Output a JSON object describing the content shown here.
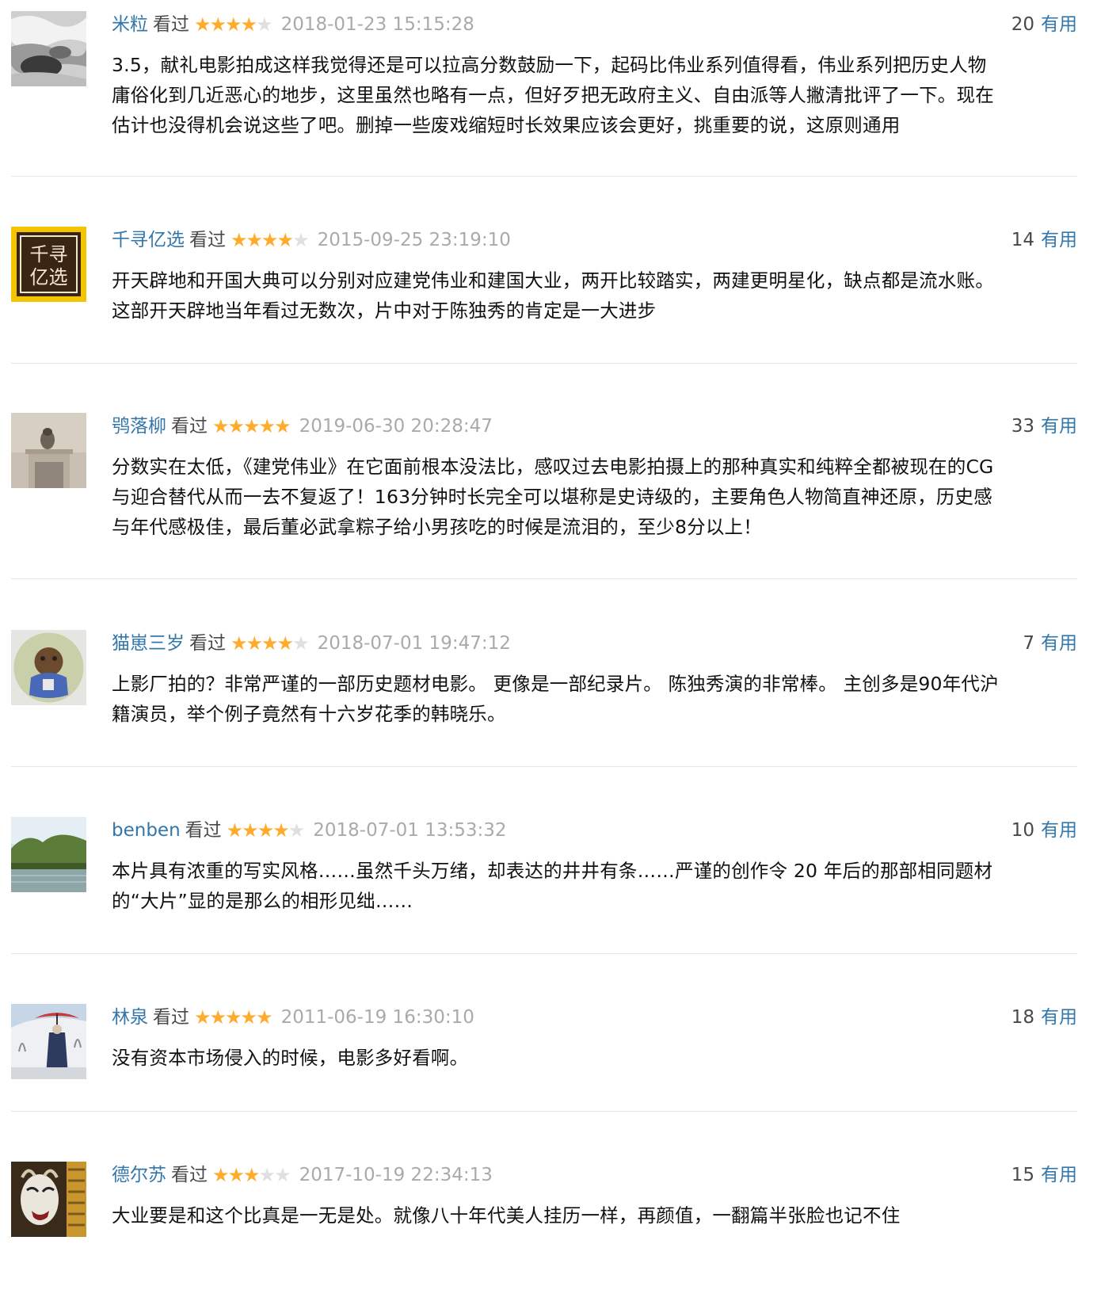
{
  "comments": [
    {
      "user": "米粒",
      "status": "看过",
      "rating": 4,
      "time": "2018-01-23 15:15:28",
      "votes": "20",
      "useful_label": "有用",
      "lines": [
        "3.5，献礼电影拍成这样我觉得还是可以拉高分数鼓励一下，起码比伟业系列值得看，伟业系列把历史人物",
        "庸俗化到几近恶心的地步，这里虽然也略有一点，但好歹把无政府主义、自由派等人撇清批评了一下。现在",
        "估计也没得机会说这些了吧。删掉一些废戏缩短时长效果应该会更好，挑重要的说，这原则通用"
      ]
    },
    {
      "user": "千寻亿选",
      "status": "看过",
      "rating": 4,
      "time": "2015-09-25 23:19:10",
      "votes": "14",
      "useful_label": "有用",
      "avatar_text": [
        "千寻",
        "亿选"
      ],
      "lines": [
        "开天辟地和开国大典可以分别对应建党伟业和建国大业，两开比较踏实，两建更明星化，缺点都是流水账。",
        "这部开天辟地当年看过无数次，片中对于陈独秀的肯定是一大进步"
      ]
    },
    {
      "user": "鸮落柳",
      "status": "看过",
      "rating": 5,
      "time": "2019-06-30 20:28:47",
      "votes": "33",
      "useful_label": "有用",
      "lines": [
        "分数实在太低，《建党伟业》在它面前根本没法比，感叹过去电影拍摄上的那种真实和纯粹全都被现在的CG",
        "与迎合替代从而一去不复返了！163分钟时长完全可以堪称是史诗级的，主要角色人物简直神还原，历史感",
        "与年代感极佳，最后董必武拿粽子给小男孩吃的时候是流泪的，至少8分以上！"
      ]
    },
    {
      "user": "猫崽三岁",
      "status": "看过",
      "rating": 4,
      "time": "2018-07-01 19:47:12",
      "votes": "7",
      "useful_label": "有用",
      "lines": [
        "上影厂拍的？非常严谨的一部历史题材电影。 更像是一部纪录片。 陈独秀演的非常棒。 主创多是90年代沪",
        "籍演员，举个例子竟然有十六岁花季的韩晓乐。"
      ]
    },
    {
      "user": "benben",
      "status": "看过",
      "rating": 4,
      "time": "2018-07-01 13:53:32",
      "votes": "10",
      "useful_label": "有用",
      "lines": [
        "本片具有浓重的写实风格……虽然千头万绪，却表达的井井有条……严谨的创作令 20 年后的那部相同题材",
        "的“大片”显的是那么的相形见绌……"
      ]
    },
    {
      "user": "林泉",
      "status": "看过",
      "rating": 5,
      "time": "2011-06-19 16:30:10",
      "votes": "18",
      "useful_label": "有用",
      "lines": [
        "没有资本市场侵入的时候，电影多好看啊。"
      ]
    },
    {
      "user": "德尔苏",
      "status": "看过",
      "rating": 3,
      "time": "2017-10-19 22:34:13",
      "votes": "15",
      "useful_label": "有用",
      "lines": [
        "大业要是和这个比真是一无是处。就像八十年代美人挂历一样，再颜值，一翻篇半张脸也记不住"
      ]
    }
  ]
}
